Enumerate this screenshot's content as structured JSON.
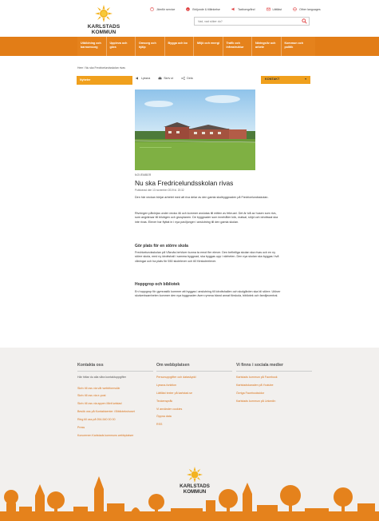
{
  "header": {
    "logo_text": "KARLSTADS KOMMUN",
    "top_links": [
      {
        "icon": "accessibility-icon",
        "label": "Jämför service"
      },
      {
        "icon": "info-icon",
        "label": "Bröjunde & tillänkelse"
      },
      {
        "icon": "speaker-icon",
        "label": "Taxitomgrånd"
      },
      {
        "icon": "mail-icon",
        "label": "Lättläst"
      },
      {
        "icon": "globe-icon",
        "label": "Other languages"
      }
    ],
    "search_placeholder": "Vad, vad söker du?"
  },
  "nav": {
    "items": [
      "Utbildning och barnomsorg",
      "Uppleva och göra",
      "Omsorg och hjälp",
      "Bygga och bo",
      "Miljö och energi",
      "Trafik och infrastruktur",
      "Näringsliv och arbete",
      "Kommun och politik"
    ]
  },
  "breadcrumb": "Hem / Nu ska Fredricelundsskolan rivas",
  "sidebar": {
    "tab_label": "Nyheter"
  },
  "tools": [
    {
      "icon": "speaker-icon",
      "label": "Lyssna"
    },
    {
      "icon": "print-icon",
      "label": "Skriv ut"
    },
    {
      "icon": "share-icon",
      "label": "Dela"
    }
  ],
  "contact_button": "KONTAKT",
  "article": {
    "kicker": "NOVEMBER",
    "title": "Nu ska Fredricelundsskolan rivas",
    "published": "Publicerad den 13 november 2019 kl. 20:32",
    "intro": "Den här veckan börjar arbetet med att riva delar av den gamla skolbyggnaden på Fredricelundsskolan.",
    "p1": "Rivningen påbörjas under vecka 46 och kommer avslutas till mitten av februari. Det är två av husen som rivs, som angränsar till bilvägen och grusplanen. De byggnader som innehåller kök, matsal, slöjd och idrottssal ska inte rivas. Elever har flyttat in i nya paviljonger i anslutning till den gamla skolan.",
    "h1": "Gör plats för en större skola",
    "p2": "Fredricelundsskolan på Våxnäs behöver kunna ta emot fler elever. Den befintliga skolan ska rivas och en ny större skola, med ny idrottshall i samma byggnad, ska byggas upp i närheten. Den nya skolan ska byggas i två våningar och ha plats för 550 skolelever och 60 förskoleelever.",
    "h2": "Hoppgrop och bibliotek",
    "p3": "En hoppgrop för gymnastik kommer att byggas i anslutning till idrottshallen och skolgården ska bli större. Utöver skolverksamheten kommer den nya byggnaden även rymma bland annat förskola, bibliotek och familjecentral."
  },
  "footer": {
    "col1": {
      "heading": "Kontakta oss",
      "intro": "Här hittar du alla våra kontaktuppgifter",
      "links": [
        "Skriv till oss via vår webbformulär",
        "Skriv till oss via e-post",
        "Skriv till oss via appen MinKarlstad",
        "Besök oss på Kontaktcenter i Bibliotekshuset",
        "Ring till oss på 054-540 00 00",
        "Press",
        "Koncernen Karlstads kommuns webbplatser"
      ]
    },
    "col2": {
      "heading": "Om webbplatsen",
      "links": [
        "Personuppgifter och dataskydd",
        "Lyssna-funktion",
        "Lättläst texter på karlstad.se",
        "Teckenspråk",
        "Vi använder cookies",
        "Öppna data",
        "RSS"
      ]
    },
    "col3": {
      "heading": "Vi finns i sociala medier",
      "links": [
        "Karlstads kommun på Facebook",
        "Karlstadskanalen på Youtube",
        "Övriga Facebooksidor",
        "Karlstads kommun på LinkedIn"
      ]
    },
    "logo_text": "KARLSTADS KOMMUN"
  },
  "colors": {
    "brand_orange": "#e5821c",
    "accent_yellow": "#f0a01d",
    "link_orange": "#d9731a",
    "footer_bg": "#f2f0ee"
  }
}
